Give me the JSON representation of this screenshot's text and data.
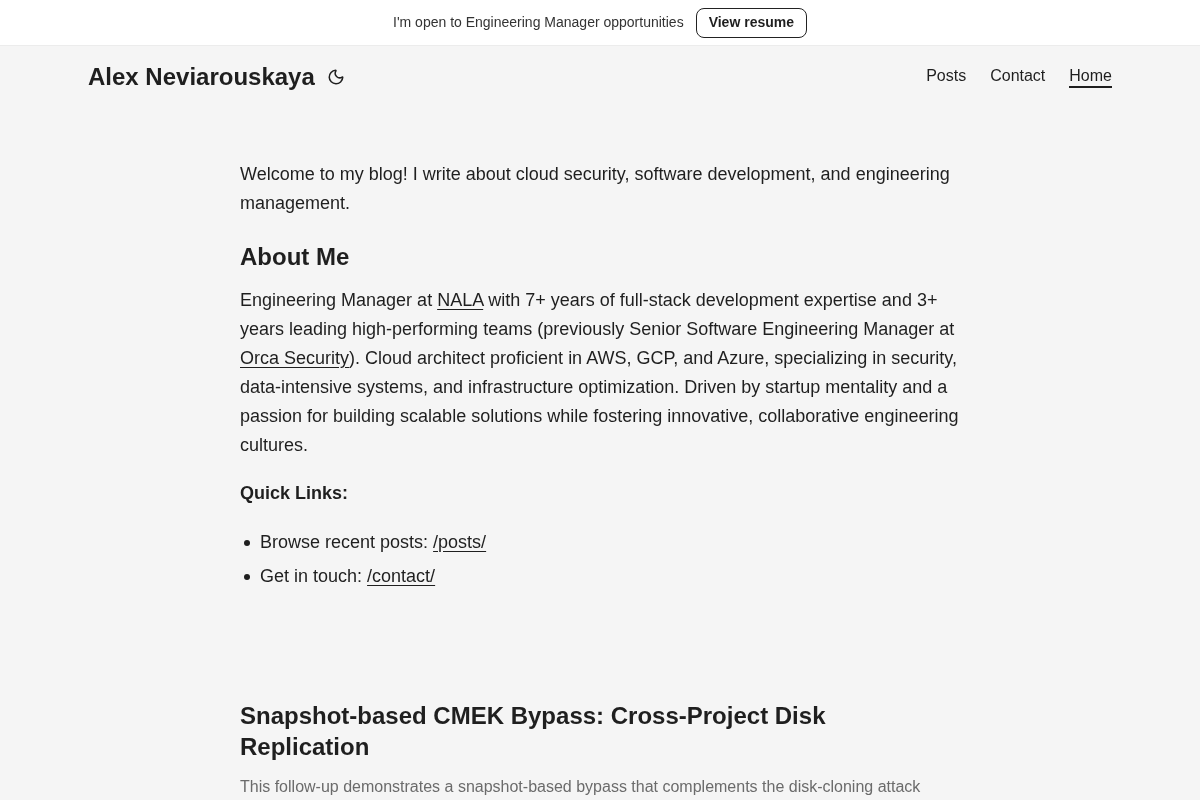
{
  "banner": {
    "text": "I'm open to Engineering Manager opportunities",
    "button": "View resume"
  },
  "header": {
    "title": "Alex Neviarouskaya",
    "nav": [
      {
        "label": "Posts",
        "selected": false
      },
      {
        "label": "Contact",
        "selected": false
      },
      {
        "label": "Home",
        "selected": true
      }
    ]
  },
  "intro": "Welcome to my blog! I write about cloud security, software development, and engineering management.",
  "about": {
    "heading": "About Me",
    "paragraph": [
      {
        "kind": "text",
        "text": "Engineering Manager at "
      },
      {
        "kind": "link",
        "text": "NALA"
      },
      {
        "kind": "text",
        "text": " with 7+ years of full-stack development expertise and 3+ years leading high-performing teams (previously Senior Software Engineering Manager at "
      },
      {
        "kind": "link",
        "text": "Orca Security"
      },
      {
        "kind": "text",
        "text": "). Cloud architect proficient in AWS, GCP, and Azure, specializing in security, data-intensive systems, and infrastructure optimization. Driven by startup mentality and a passion for building scalable solutions while fostering innovative, collaborative engineering cultures."
      }
    ]
  },
  "quick_links": {
    "heading": "Quick Links:",
    "items": [
      {
        "text": "Browse recent posts:",
        "link": "/posts/"
      },
      {
        "text": "Get in touch:",
        "link": "/contact/"
      }
    ]
  },
  "posts": [
    {
      "title": "Snapshot-based CMEK Bypass: Cross-Project Disk Replication",
      "excerpt": "This follow-up demonstrates a snapshot-based bypass that complements the disk-cloning attack"
    }
  ]
}
